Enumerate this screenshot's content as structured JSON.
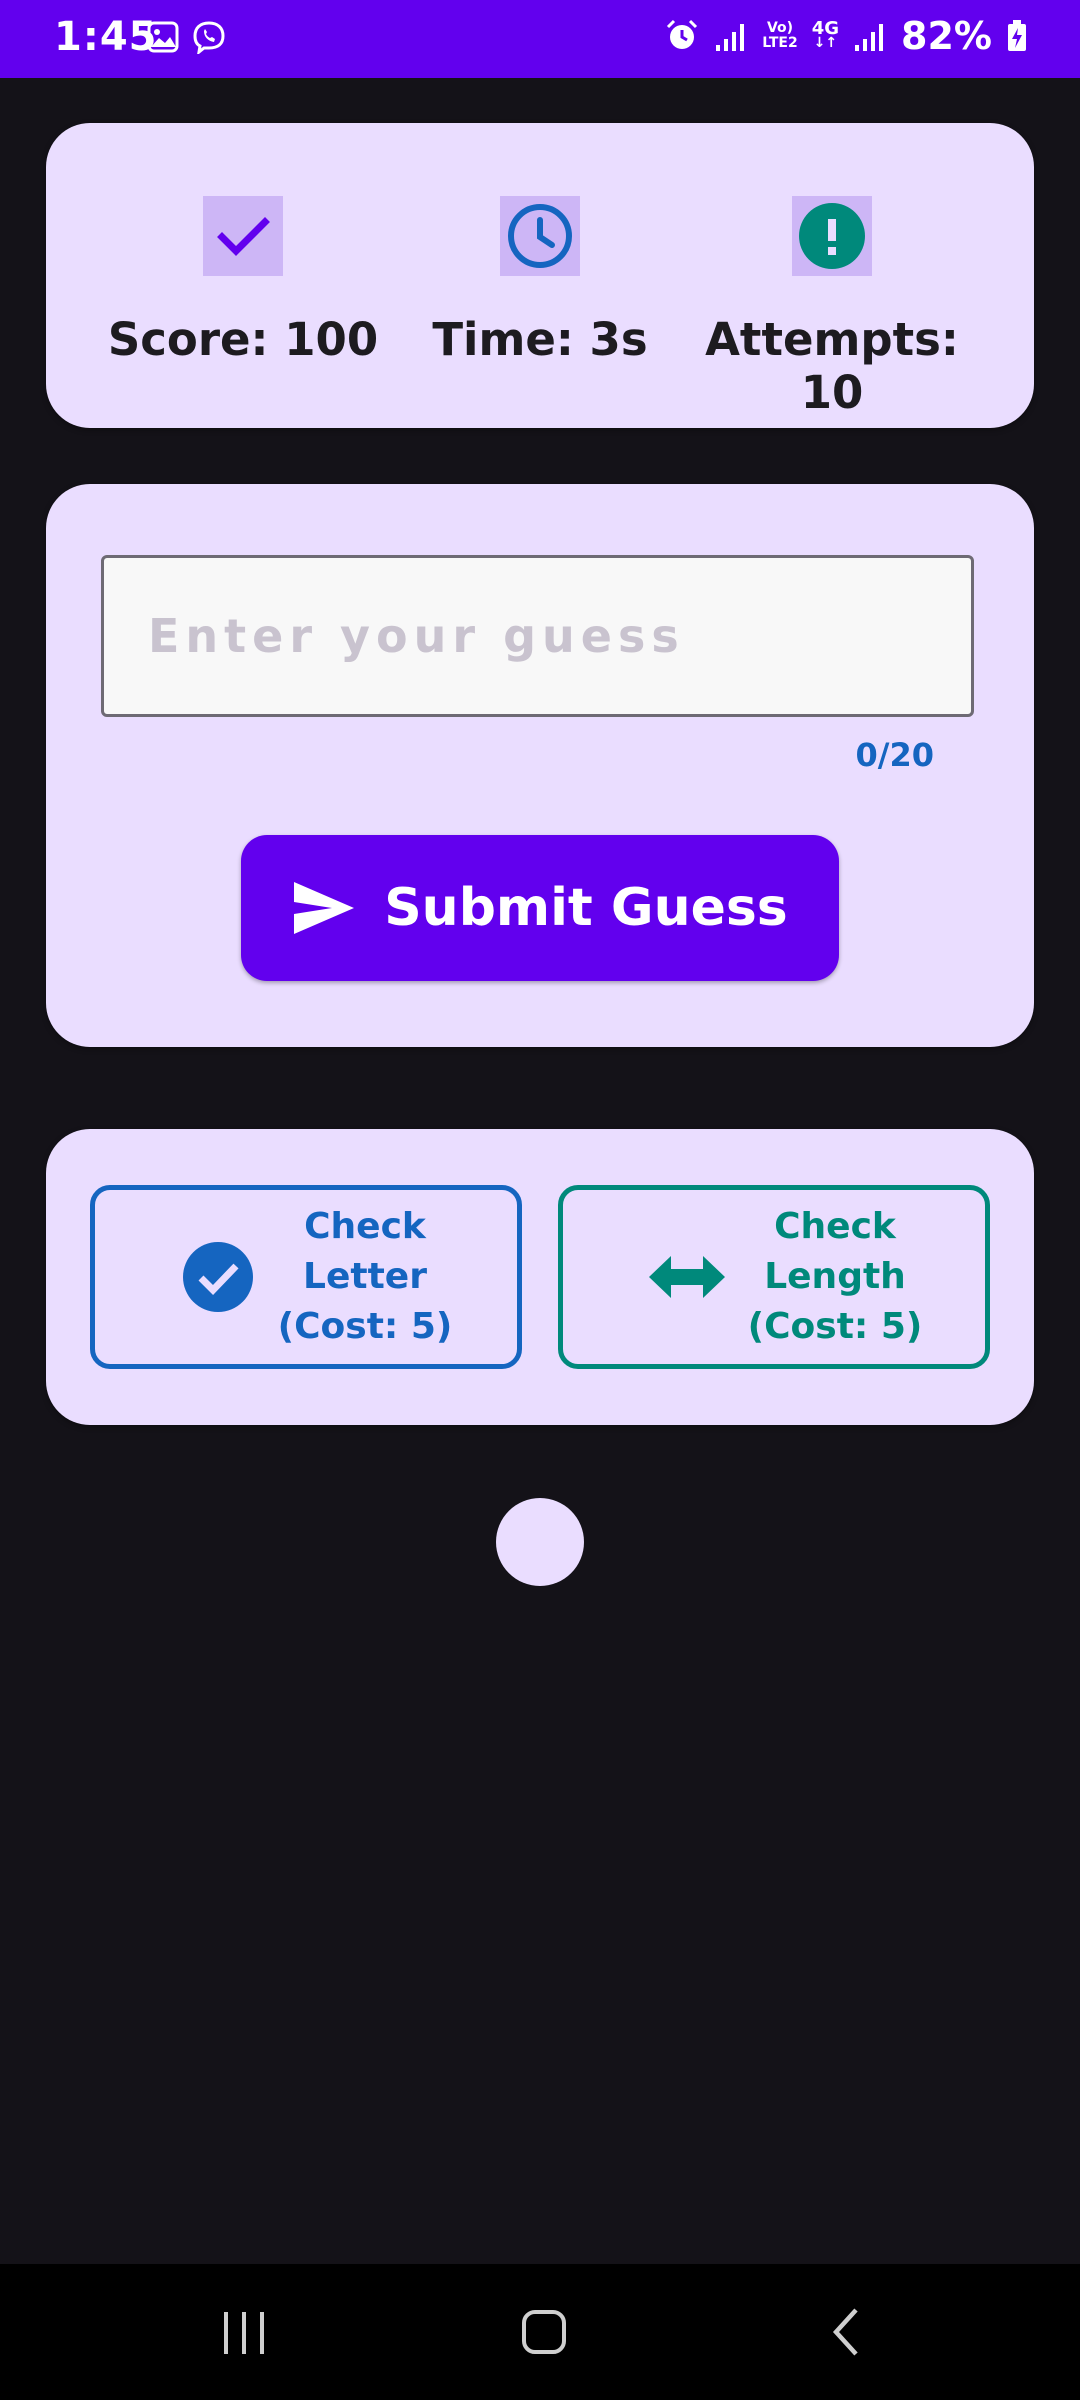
{
  "status_bar": {
    "time": "1:45",
    "battery": "82%",
    "network_top": "Vo)",
    "network_bottom": "LTE2",
    "network_gen": "4G",
    "left_icons": [
      "gallery-icon",
      "viber-icon"
    ],
    "right_icons": [
      "alarm-icon",
      "signal-icon",
      "signal-icon",
      "battery-charging-icon"
    ]
  },
  "stats": {
    "score_label": "Score: 100",
    "time_label": "Time: 3s",
    "attempts_label": "Attempts: 10",
    "icons": [
      "check-icon",
      "clock-icon",
      "alert-icon"
    ]
  },
  "guess": {
    "input_value": "",
    "placeholder": "Enter your guess",
    "counter": "0/20",
    "submit_label": "Submit Guess"
  },
  "hints": {
    "check_letter_label": "Check\nLetter\n(Cost: 5)",
    "check_length_label": "Check\nLength\n(Cost: 5)"
  },
  "colors": {
    "primary": "#6200EE",
    "card_bg": "#EADDFF",
    "background": "#141218",
    "blue": "#1565C0",
    "teal": "#00897B"
  },
  "nav_bar": {
    "icons": [
      "recent-apps-icon",
      "home-icon",
      "back-icon"
    ]
  }
}
